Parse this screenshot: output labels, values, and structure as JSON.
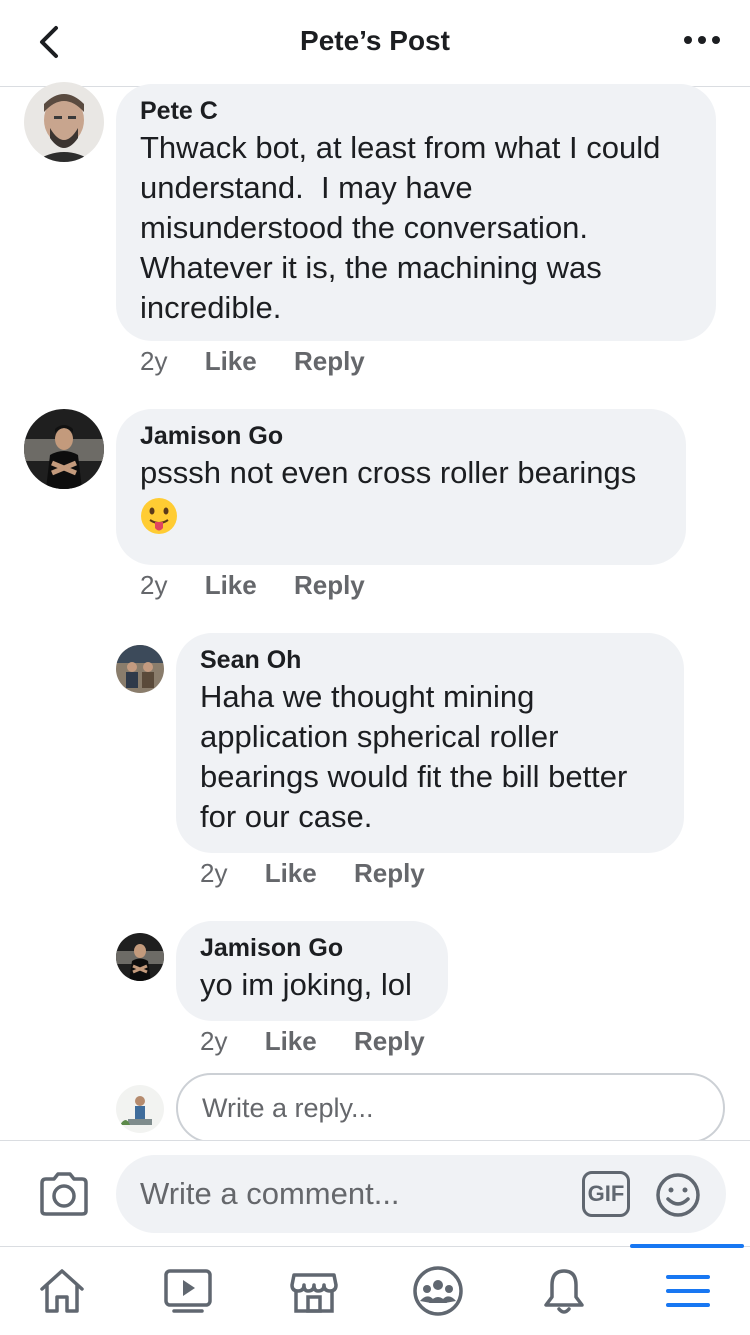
{
  "header": {
    "title": "Pete’s Post"
  },
  "comments": [
    {
      "author": "Pete C",
      "text": "Thwack bot, at least from what I could\nunderstand.  I may have\nmisunderstood the conversation.\nWhatever it is, the machining was\nincredible.",
      "age": "2y",
      "like": "Like",
      "reply": "Reply"
    },
    {
      "author": "Jamison Go",
      "text": "psssh not even cross roller bearings",
      "emoji": "face-with-tongue",
      "age": "2y",
      "like": "Like",
      "reply": "Reply"
    },
    {
      "author": "Sean Oh",
      "text": "Haha we thought mining\napplication spherical roller\nbearings would fit the bill better\nfor our case.",
      "age": "2y",
      "like": "Like",
      "reply": "Reply"
    },
    {
      "author": "Jamison Go",
      "text": "yo im joking, lol",
      "age": "2y",
      "like": "Like",
      "reply": "Reply"
    }
  ],
  "reply_composer": {
    "placeholder": "Write a reply..."
  },
  "comment_bar": {
    "placeholder": "Write a comment...",
    "gif_label": "GIF"
  },
  "tabbar": {
    "items": [
      "home-icon",
      "watch-icon",
      "marketplace-icon",
      "groups-icon",
      "notifications-icon",
      "menu-icon"
    ],
    "active": "menu-icon",
    "accent": "#1877f2"
  },
  "colors": {
    "bubble": "#f0f2f5",
    "meta": "#65676b"
  }
}
